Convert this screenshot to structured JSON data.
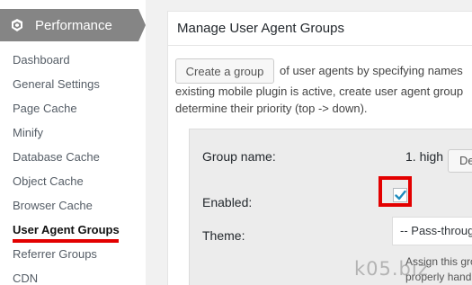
{
  "sidebar": {
    "header": {
      "title": "Performance",
      "icon": "w3tc-performance-icon"
    },
    "items": [
      {
        "label": "Dashboard"
      },
      {
        "label": "General Settings"
      },
      {
        "label": "Page Cache"
      },
      {
        "label": "Minify"
      },
      {
        "label": "Database Cache"
      },
      {
        "label": "Object Cache"
      },
      {
        "label": "Browser Cache"
      },
      {
        "label": "User Agent Groups",
        "active": true
      },
      {
        "label": "Referrer Groups"
      },
      {
        "label": "CDN"
      }
    ],
    "active_underline_color": "#e30000"
  },
  "main": {
    "title": "Manage User Agent Groups",
    "create_button_label": "Create a group",
    "intro_lines": [
      "of user agents by specifying names",
      "existing mobile plugin is active, create user agent group",
      "determine their priority (top -> down)."
    ],
    "group": {
      "name_label": "Group name:",
      "priority": "1. high",
      "delete_button_label": "Delete",
      "enabled_label": "Enabled:",
      "enabled_checked": true,
      "theme_label": "Theme:",
      "theme_value": "-- Pass-through --",
      "theme_help_lines": [
        "Assign this group",
        "properly handle"
      ]
    }
  },
  "annotation": {
    "highlight_color": "#e30000"
  },
  "watermark": "k05.biz"
}
